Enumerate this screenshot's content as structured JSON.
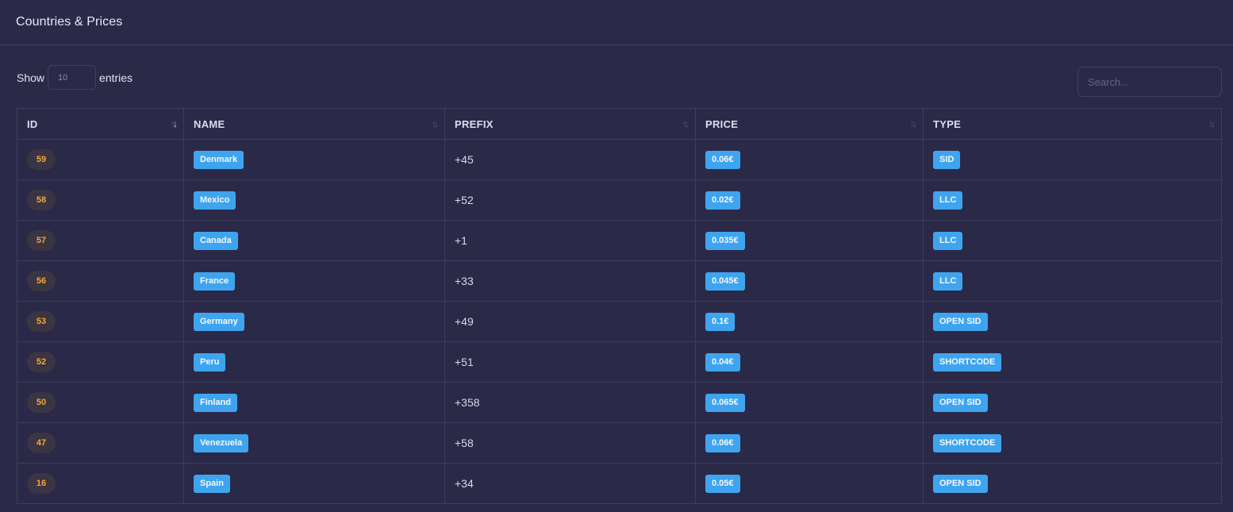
{
  "header": {
    "title": "Countries & Prices"
  },
  "length_control": {
    "prefix": "Show",
    "value": "10",
    "suffix": "entries"
  },
  "search": {
    "placeholder": "Search...",
    "value": ""
  },
  "table": {
    "sort": {
      "column": "ID",
      "direction": "descending"
    },
    "columns": [
      "ID",
      "NAME",
      "PREFIX",
      "PRICE",
      "TYPE"
    ],
    "rows": [
      {
        "id": "59",
        "name": "Denmark",
        "prefix": "+45",
        "price": "0.06€",
        "type": "SID"
      },
      {
        "id": "58",
        "name": "Mexico",
        "prefix": "+52",
        "price": "0.02€",
        "type": "LLC"
      },
      {
        "id": "57",
        "name": "Canada",
        "prefix": "+1",
        "price": "0.035€",
        "type": "LLC"
      },
      {
        "id": "56",
        "name": "France",
        "prefix": "+33",
        "price": "0.045€",
        "type": "LLC"
      },
      {
        "id": "53",
        "name": "Germany",
        "prefix": "+49",
        "price": "0.1€",
        "type": "OPEN SID"
      },
      {
        "id": "52",
        "name": "Peru",
        "prefix": "+51",
        "price": "0.04€",
        "type": "SHORTCODE"
      },
      {
        "id": "50",
        "name": "Finland",
        "prefix": "+358",
        "price": "0.065€",
        "type": "OPEN SID"
      },
      {
        "id": "47",
        "name": "Venezuela",
        "prefix": "+58",
        "price": "0.06€",
        "type": "SHORTCODE"
      },
      {
        "id": "16",
        "name": "Spain",
        "prefix": "+34",
        "price": "0.05€",
        "type": "OPEN SID"
      }
    ]
  },
  "colors": {
    "background": "#2a2a48",
    "badge_blue": "#3fa4ef",
    "id_text": "#f3a73b",
    "id_bg": "#3b3442",
    "border": "#3d3d5e"
  }
}
